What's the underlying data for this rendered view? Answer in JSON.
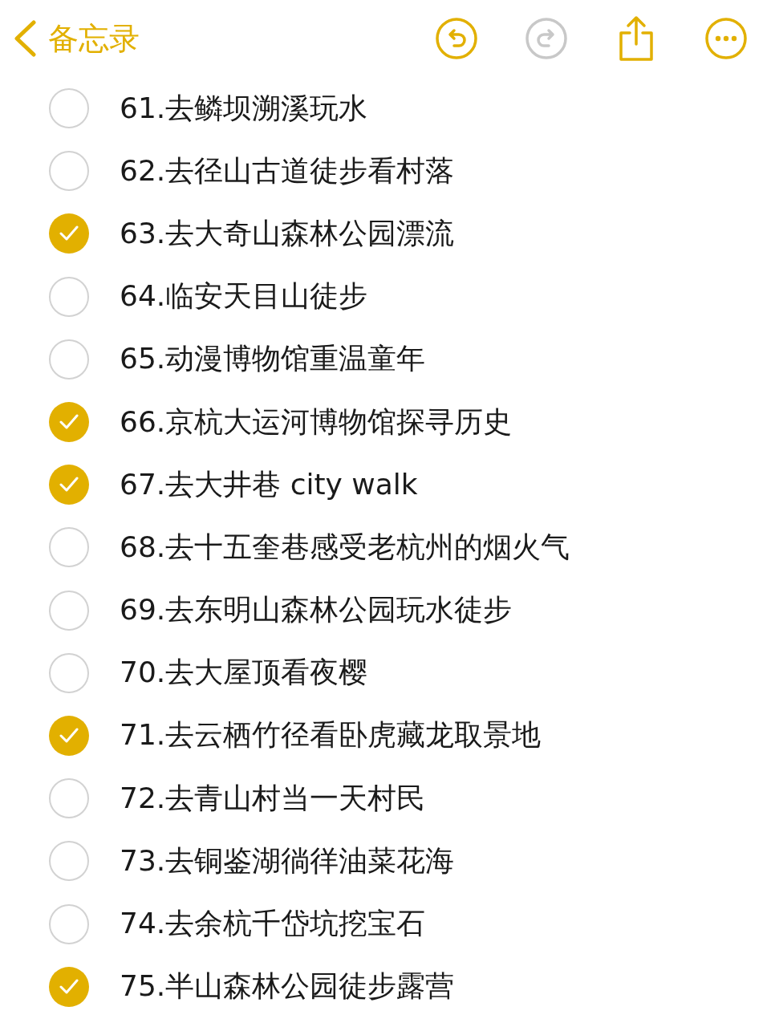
{
  "header": {
    "back_label": "备忘录",
    "undo": {
      "disabled": false
    },
    "redo": {
      "disabled": true
    }
  },
  "items": [
    {
      "text": "61.去鳞坝溯溪玩水",
      "checked": false
    },
    {
      "text": "62.去径山古道徒步看村落",
      "checked": false
    },
    {
      "text": "63.去大奇山森林公园漂流",
      "checked": true
    },
    {
      "text": "64.临安天目山徒步",
      "checked": false
    },
    {
      "text": "65.动漫博物馆重温童年",
      "checked": false
    },
    {
      "text": "66.京杭大运河博物馆探寻历史",
      "checked": true
    },
    {
      "text": "67.去大井巷 city walk",
      "checked": true
    },
    {
      "text": "68.去十五奎巷感受老杭州的烟火气",
      "checked": false
    },
    {
      "text": "69.去东明山森林公园玩水徒步",
      "checked": false
    },
    {
      "text": "70.去大屋顶看夜樱",
      "checked": false
    },
    {
      "text": "71.去云栖竹径看卧虎藏龙取景地",
      "checked": true
    },
    {
      "text": "72.去青山村当一天村民",
      "checked": false
    },
    {
      "text": "73.去铜鉴湖徜徉油菜花海",
      "checked": false
    },
    {
      "text": "74.去余杭千岱坑挖宝石",
      "checked": false
    },
    {
      "text": "75.半山森林公园徒步露营",
      "checked": true
    }
  ]
}
